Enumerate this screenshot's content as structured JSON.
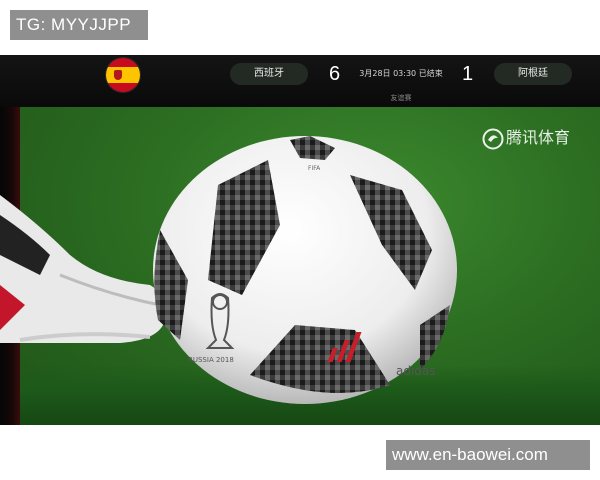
{
  "overlay": {
    "top_left_text": "TG: MYYJJPP",
    "bottom_right_text": "www.en-baowei.com"
  },
  "scoreboard": {
    "home_team": "西班牙",
    "away_team": "阿根廷",
    "home_score": "6",
    "away_score": "1",
    "match_time": "3月28日 03:30 已结束",
    "match_type": "友谊赛",
    "home_flag_icon": "spain-flag-icon"
  },
  "video": {
    "watermark_text": "腾讯体育",
    "watermark_icon": "tencent-sports-logo-icon",
    "ball_brand": "adidas",
    "ball_event_text": "FIFA WORLD CUP RUSSIA 2018"
  },
  "colors": {
    "badge_bg": "#8f8f8f",
    "scoreboard_bg": "#0f0f0f",
    "pill_bg": "#232a24",
    "pitch_green": "#2c6e22"
  }
}
